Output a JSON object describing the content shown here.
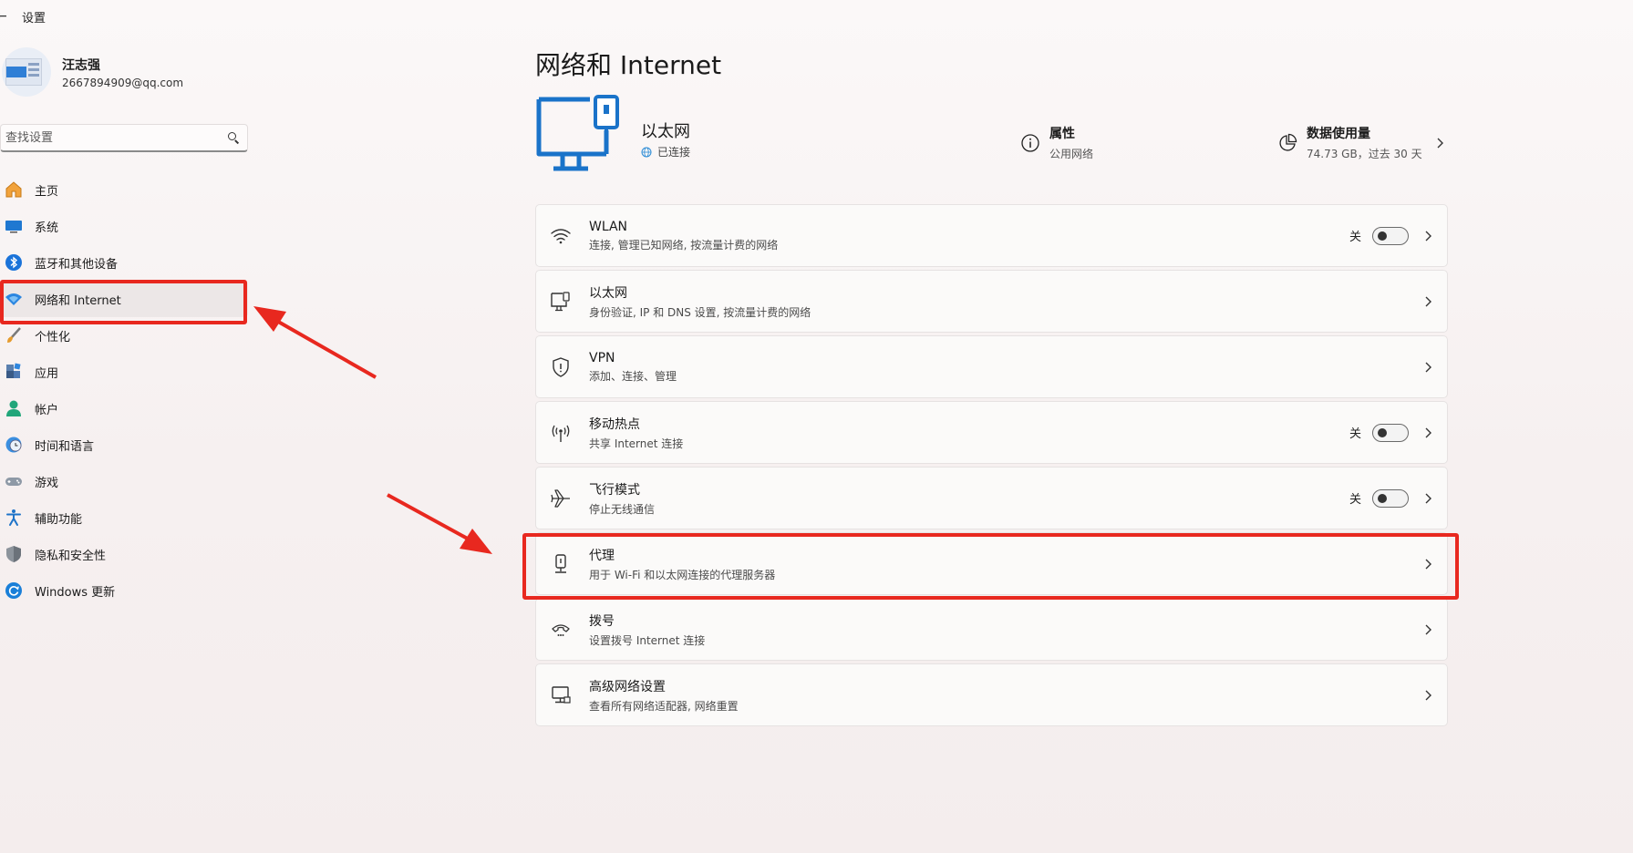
{
  "window": {
    "title": "设置"
  },
  "profile": {
    "name": "汪志强",
    "email": "2667894909@qq.com"
  },
  "search": {
    "placeholder": "查找设置"
  },
  "sidebar": {
    "items": [
      {
        "id": "home",
        "label": "主页",
        "icon": "home-icon"
      },
      {
        "id": "system",
        "label": "系统",
        "icon": "system-monitor-icon"
      },
      {
        "id": "bluetooth",
        "label": "蓝牙和其他设备",
        "icon": "bluetooth-icon"
      },
      {
        "id": "network",
        "label": "网络和 Internet",
        "icon": "wifi-icon",
        "selected": true
      },
      {
        "id": "personalization",
        "label": "个性化",
        "icon": "brush-icon"
      },
      {
        "id": "apps",
        "label": "应用",
        "icon": "apps-icon"
      },
      {
        "id": "accounts",
        "label": "帐户",
        "icon": "person-icon"
      },
      {
        "id": "time",
        "label": "时间和语言",
        "icon": "clock-globe-icon"
      },
      {
        "id": "gaming",
        "label": "游戏",
        "icon": "gamepad-icon"
      },
      {
        "id": "accessibility",
        "label": "辅助功能",
        "icon": "accessibility-icon"
      },
      {
        "id": "privacy",
        "label": "隐私和安全性",
        "icon": "shield-icon"
      },
      {
        "id": "update",
        "label": "Windows 更新",
        "icon": "refresh-icon"
      }
    ]
  },
  "main": {
    "title": "网络和 Internet",
    "hero": {
      "name": "以太网",
      "status": "已连接",
      "properties": {
        "title": "属性",
        "subtitle": "公用网络"
      },
      "usage": {
        "title": "数据使用量",
        "subtitle": "74.73 GB，过去 30 天"
      }
    },
    "cards": [
      {
        "id": "wlan",
        "title": "WLAN",
        "desc": "连接, 管理已知网络, 按流量计费的网络",
        "toggle": "关",
        "icon": "wifi-icon"
      },
      {
        "id": "ethernet",
        "title": "以太网",
        "desc": "身份验证, IP 和 DNS 设置, 按流量计费的网络",
        "icon": "ethernet-icon"
      },
      {
        "id": "vpn",
        "title": "VPN",
        "desc": "添加、连接、管理",
        "icon": "vpn-shield-icon"
      },
      {
        "id": "hotspot",
        "title": "移动热点",
        "desc": "共享 Internet 连接",
        "toggle": "关",
        "icon": "hotspot-icon"
      },
      {
        "id": "airplane",
        "title": "飞行模式",
        "desc": "停止无线通信",
        "toggle": "关",
        "icon": "airplane-icon"
      },
      {
        "id": "proxy",
        "title": "代理",
        "desc": "用于 Wi-Fi 和以太网连接的代理服务器",
        "icon": "proxy-icon"
      },
      {
        "id": "dialup",
        "title": "拨号",
        "desc": "设置拨号 Internet 连接",
        "icon": "dialup-icon"
      },
      {
        "id": "advanced",
        "title": "高级网络设置",
        "desc": "查看所有网络适配器, 网络重置",
        "icon": "advanced-network-icon"
      }
    ]
  },
  "colors": {
    "accent": "#0067c0",
    "annotation": "#e8281f"
  }
}
